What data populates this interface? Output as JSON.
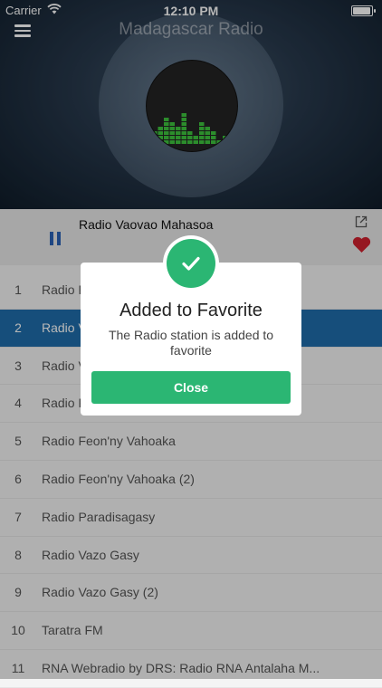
{
  "status_bar": {
    "carrier": "Carrier",
    "time": "12:10 PM"
  },
  "header": {
    "title": "Madagascar Radio"
  },
  "now_playing": {
    "station": "Radio Vaovao Mahasoa"
  },
  "stations": [
    {
      "num": "1",
      "name": "Radio Fanambarana"
    },
    {
      "num": "2",
      "name": "Radio Vaovao Mahasoa"
    },
    {
      "num": "3",
      "name": "Radio Vaovao Mahasoa (2)"
    },
    {
      "num": "4",
      "name": "Radio Feon'ny Vahoaka Mafy"
    },
    {
      "num": "5",
      "name": "Radio Feon'ny Vahoaka"
    },
    {
      "num": "6",
      "name": "Radio Feon'ny Vahoaka (2)"
    },
    {
      "num": "7",
      "name": "Radio Paradisagasy"
    },
    {
      "num": "8",
      "name": "Radio Vazo Gasy"
    },
    {
      "num": "9",
      "name": "Radio Vazo Gasy (2)"
    },
    {
      "num": "10",
      "name": "Taratra FM"
    },
    {
      "num": "11",
      "name": "RNA Webradio by DRS: Radio RNA Antalaha M..."
    }
  ],
  "selected_index": 1,
  "dialog": {
    "title": "Added to Favorite",
    "message": "The Radio station is added to favorite",
    "close_label": "Close"
  },
  "colors": {
    "accent_green": "#2bb673",
    "selected_row": "#1f6dab",
    "pause_blue": "#2a62b6",
    "heart_red": "#d0202e",
    "equalizer_green": "#3ec43e"
  },
  "icons": {
    "menu": "menu-icon",
    "pause": "pause-icon",
    "share": "share-icon",
    "favorite": "heart-icon",
    "success": "checkmark-icon"
  }
}
